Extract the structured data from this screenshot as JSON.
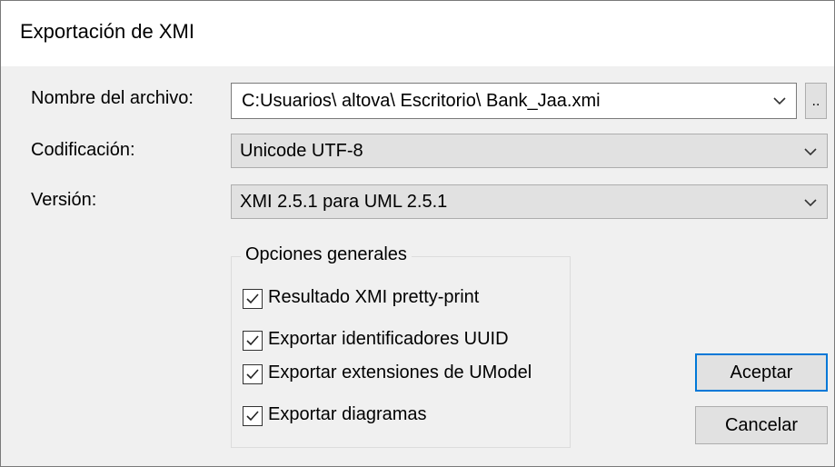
{
  "window": {
    "title": "Exportación de XMI"
  },
  "form": {
    "filename": {
      "label": "Nombre del archivo:",
      "value": "C:Usuarios\\ altova\\ Escritorio\\ Bank_Jaa.xmi",
      "browse_label": ".."
    },
    "encoding": {
      "label": "Codificación:",
      "value": "Unicode UTF-8"
    },
    "version": {
      "label": "Versión:",
      "value": "XMI 2.5.1 para UML 2.5.1"
    }
  },
  "options": {
    "title": "Opciones generales",
    "items": [
      {
        "label": "Resultado XMI pretty-print",
        "checked": true
      },
      {
        "label": "Exportar identificadores UUID",
        "checked": true
      },
      {
        "label": "Exportar extensiones de UModel",
        "checked": true
      },
      {
        "label": "Exportar diagramas",
        "checked": true
      }
    ]
  },
  "buttons": {
    "ok_label": "Aceptar",
    "cancel_label": "Cancelar"
  },
  "icons": {
    "dropdown": "chevron-down-icon",
    "check": "checkmark-icon"
  },
  "colors": {
    "accent": "#0078d7",
    "dialog_bg": "#f0f0f0",
    "control_bg": "#e1e1e1"
  }
}
